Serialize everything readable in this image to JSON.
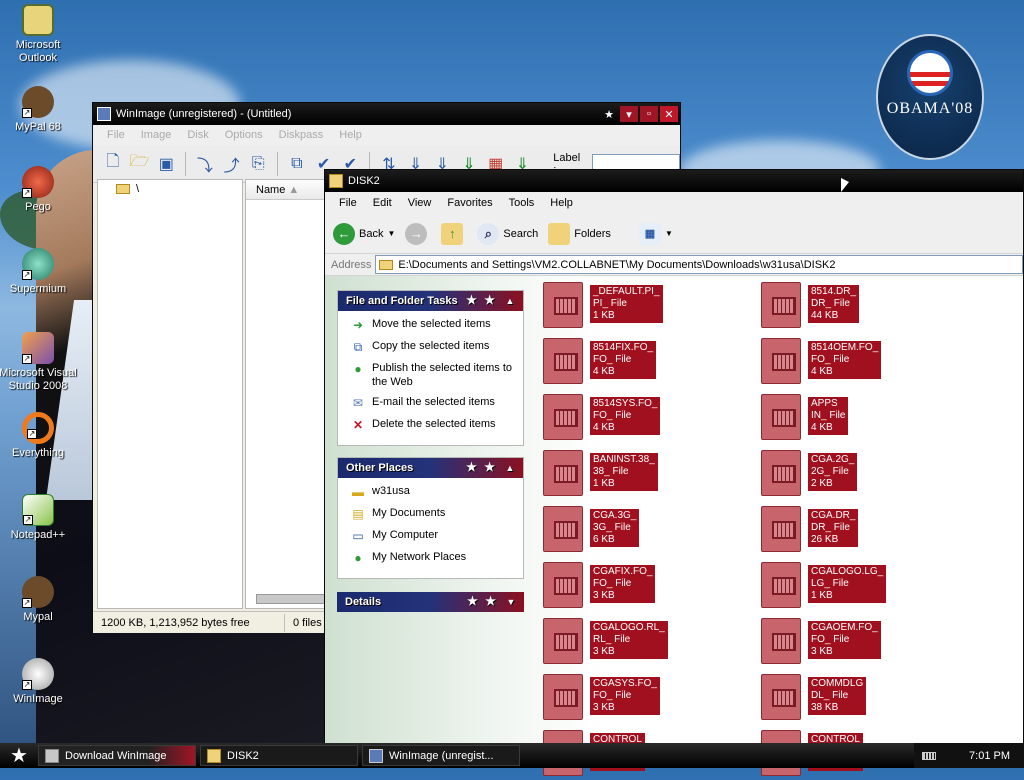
{
  "desktop": {
    "icons": [
      {
        "label": "Microsoft Outlook",
        "color": "#e8d47a"
      },
      {
        "label": "MyPal 68",
        "color": "#6b4b2a"
      },
      {
        "label": "Pego",
        "color": "#c0392b"
      },
      {
        "label": "Supermium",
        "color": "#3aa38a"
      },
      {
        "label": "Microsoft Visual Studio 2008",
        "color": "#7a4fb0"
      },
      {
        "label": "Everything",
        "color": "#f07a1a"
      },
      {
        "label": "Notepad++",
        "color": "#8bc34a"
      },
      {
        "label": "Mypal",
        "color": "#6b4b2a"
      },
      {
        "label": "WinImage",
        "color": "#c9c9c9"
      }
    ],
    "badge": {
      "title": "OBAMA'08"
    }
  },
  "winimage": {
    "title": "WinImage (unregistered) - (Untitled)",
    "menu": [
      "File",
      "Image",
      "Disk",
      "Options",
      "Diskpass",
      "Help"
    ],
    "label_text": "Label :",
    "label_value": "",
    "tree_root": "\\",
    "column_name": "Name",
    "status_free": "1200 KB, 1,213,952 bytes free",
    "status_files": "0 files"
  },
  "explorer": {
    "title": "DISK2",
    "menu": [
      "File",
      "Edit",
      "View",
      "Favorites",
      "Tools",
      "Help"
    ],
    "toolbar": {
      "back": "Back",
      "search": "Search",
      "folders": "Folders"
    },
    "address_label": "Address",
    "address": "E:\\Documents and Settings\\VM2.COLLABNET\\My Documents\\Downloads\\w31usa\\DISK2",
    "tasks": {
      "title": "File and Folder Tasks",
      "items": [
        "Move the selected items",
        "Copy the selected items",
        "Publish the selected items to the Web",
        "E-mail the selected items",
        "Delete the selected items"
      ]
    },
    "places": {
      "title": "Other Places",
      "items": [
        "w31usa",
        "My Documents",
        "My Computer",
        "My Network Places"
      ]
    },
    "details": {
      "title": "Details"
    },
    "files": [
      {
        "name": "_DEFAULT.PI_",
        "type": "PI_ File",
        "size": "1 KB"
      },
      {
        "name": "8514.DR_",
        "type": "DR_ File",
        "size": "44 KB"
      },
      {
        "name": "8514FIX.FO_",
        "type": "FO_ File",
        "size": "4 KB"
      },
      {
        "name": "8514OEM.FO_",
        "type": "FO_ File",
        "size": "4 KB"
      },
      {
        "name": "8514SYS.FO_",
        "type": "FO_ File",
        "size": "4 KB"
      },
      {
        "name": "APPS",
        "type": "IN_ File",
        "size": "4 KB"
      },
      {
        "name": "BANINST.38_",
        "type": "38_ File",
        "size": "1 KB"
      },
      {
        "name": "CGA.2G_",
        "type": "2G_ File",
        "size": "2 KB"
      },
      {
        "name": "CGA.3G_",
        "type": "3G_ File",
        "size": "6 KB"
      },
      {
        "name": "CGA.DR_",
        "type": "DR_ File",
        "size": "26 KB"
      },
      {
        "name": "CGAFIX.FO_",
        "type": "FO_ File",
        "size": "3 KB"
      },
      {
        "name": "CGALOGO.LG_",
        "type": "LG_ File",
        "size": "1 KB"
      },
      {
        "name": "CGALOGO.RL_",
        "type": "RL_ File",
        "size": "3 KB"
      },
      {
        "name": "CGAOEM.FO_",
        "type": "FO_ File",
        "size": "3 KB"
      },
      {
        "name": "CGASYS.FO_",
        "type": "FO_ File",
        "size": "3 KB"
      },
      {
        "name": "COMMDLG",
        "type": "DL_ File",
        "size": "38 KB"
      },
      {
        "name": "CONTROL",
        "type": "",
        "size": ""
      },
      {
        "name": "CONTROL",
        "type": "",
        "size": ""
      }
    ]
  },
  "taskbar": {
    "items": [
      "Download WinImage",
      "DISK2",
      "WinImage (unregist..."
    ],
    "clock": "7:01 PM"
  }
}
